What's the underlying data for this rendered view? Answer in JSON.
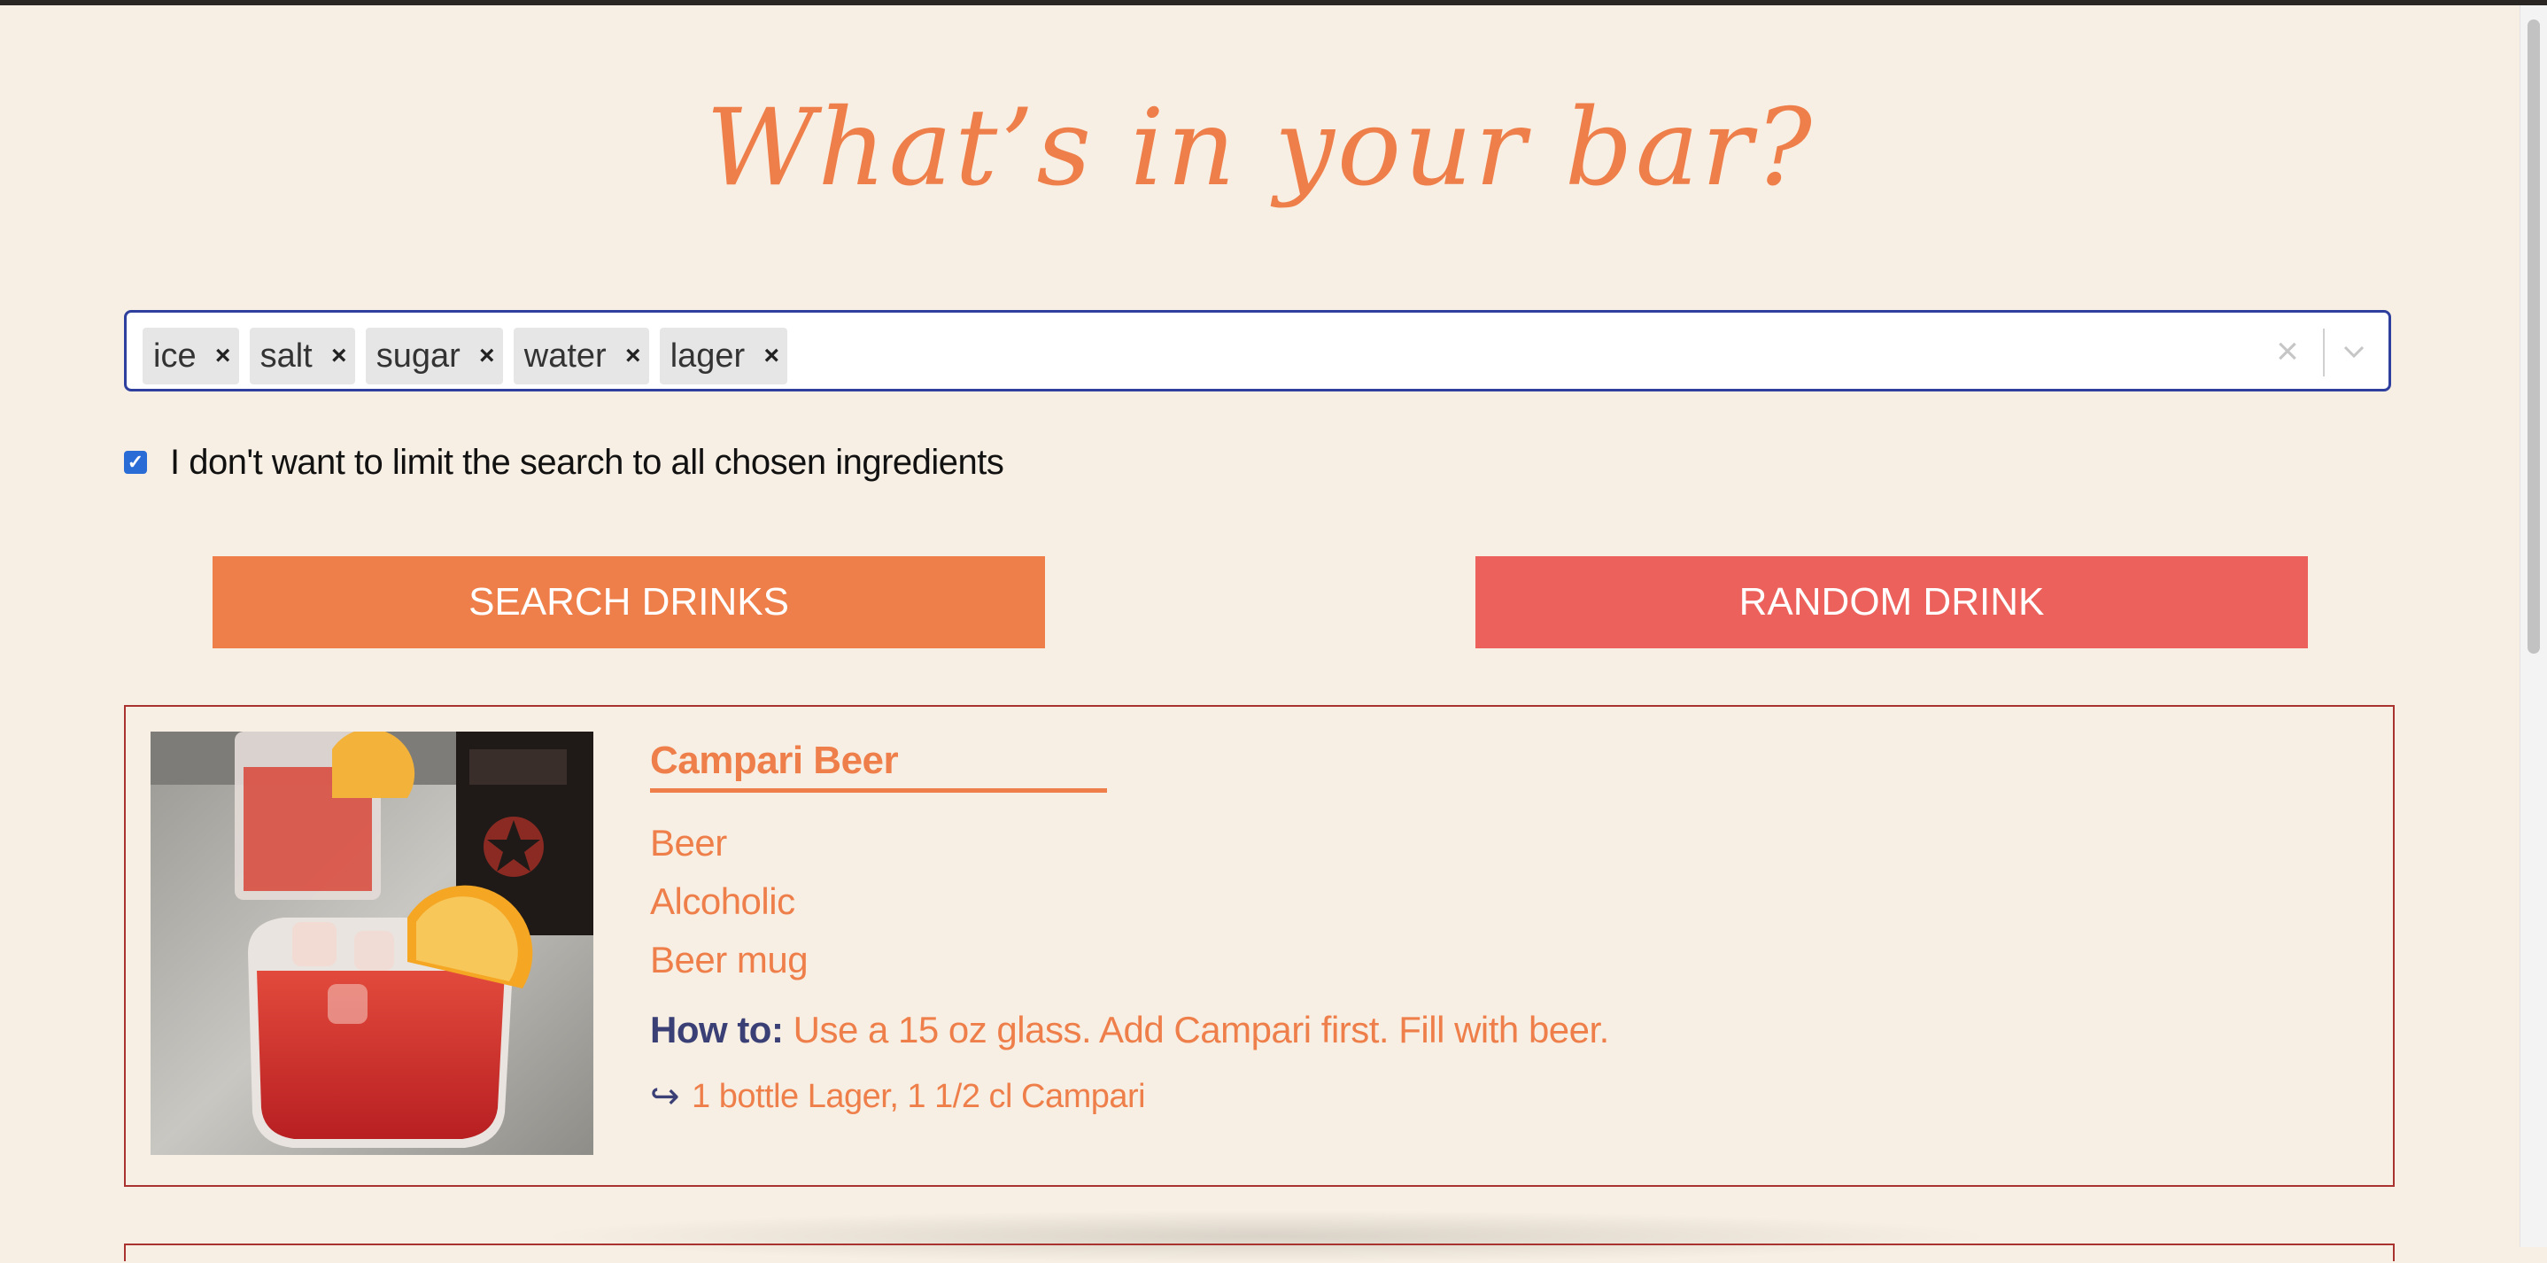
{
  "header": {
    "title": "What’s in your bar?"
  },
  "ingredient_select": {
    "chips": [
      {
        "label": "ice",
        "remove": "×"
      },
      {
        "label": "salt",
        "remove": "×"
      },
      {
        "label": "sugar",
        "remove": "×"
      },
      {
        "label": "water",
        "remove": "×"
      },
      {
        "label": "lager",
        "remove": "×"
      }
    ],
    "clear_icon": "×"
  },
  "options": {
    "limit_checkbox_checked": true,
    "limit_checkbox_label": "I don't want to limit the search to all chosen ingredients"
  },
  "buttons": {
    "search_label": "SEARCH DRINKS",
    "random_label": "RANDOM DRINK"
  },
  "results": [
    {
      "name": "Campari Beer",
      "category": "Beer",
      "alcoholic": "Alcoholic",
      "glass": "Beer mug",
      "howto_label": "How to:",
      "instructions": "Use a 15 oz glass. Add Campari first. Fill with beer.",
      "arrow_icon": "↪",
      "ingredients": "1 bottle Lager, 1 1/2 cl Campari"
    }
  ],
  "colors": {
    "background": "#f7efe3",
    "accent_orange": "#ef7f4a",
    "accent_red": "#ec615b",
    "howto_navy": "#3a3f75",
    "card_border": "#a9342f"
  }
}
